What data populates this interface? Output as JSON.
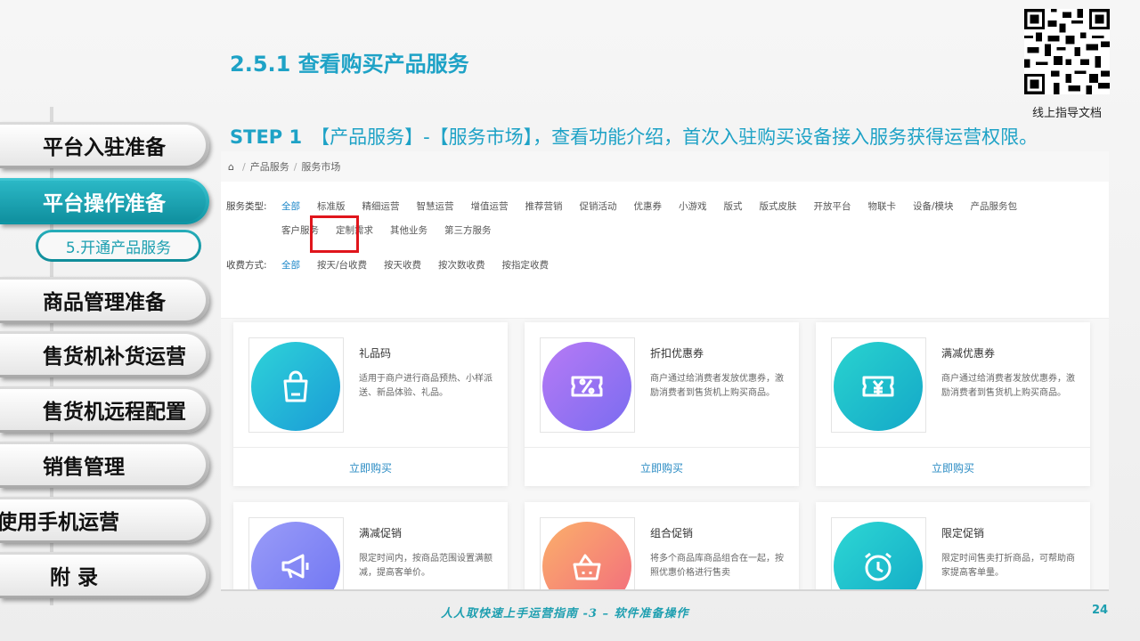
{
  "slide": {
    "title": "2.5.1 查看购买产品服务",
    "qr_label": "线上指导文档",
    "step_label": "STEP 1",
    "step_text": "【产品服务】-【服务市场】，查看功能介绍，首次入驻购买设备接入服务获得运营权限。",
    "footer": "人人取快速上手运营指南 -3 – 软件准备操作",
    "page_number": "24"
  },
  "sidebar": {
    "items": [
      {
        "label": "平台入驻准备"
      },
      {
        "label": "平台操作准备"
      },
      {
        "label": "商品管理准备"
      },
      {
        "label": "售货机补货运营"
      },
      {
        "label": "售货机远程配置"
      },
      {
        "label": "销售管理"
      },
      {
        "label": "使用手机运营"
      },
      {
        "label": "附 录"
      }
    ],
    "sub_item": "5.开通产品服务",
    "active_index": 1
  },
  "screenshot": {
    "breadcrumb": [
      "产品服务",
      "服务市场"
    ],
    "service_type_label": "服务类型:",
    "service_types": [
      "全部",
      "标准版",
      "精细运营",
      "智慧运营",
      "增值运营",
      "推荐营销",
      "促销活动",
      "优惠券",
      "小游戏",
      "版式",
      "版式皮肤",
      "开放平台",
      "物联卡",
      "设备/模块",
      "产品服务包",
      "客户服务",
      "定制需求",
      "其他业务",
      "第三方服务"
    ],
    "charge_label": "收费方式:",
    "charge_types": [
      "全部",
      "按天/台收费",
      "按天收费",
      "按次数收费",
      "按指定收费"
    ],
    "buy_label": "立即购买",
    "cards": [
      {
        "name": "礼品码",
        "desc": "适用于商户进行商品预热、小样派送、新品体验、礼品。",
        "icon": "shopping-bag-icon",
        "color_a": "#2ed3d9",
        "color_b": "#1a9bd6"
      },
      {
        "name": "折扣优惠券",
        "desc": "商户通过给消费者发放优惠券，激励消费者到售货机上购买商品。",
        "icon": "percent-coupon-icon",
        "color_a": "#b77af5",
        "color_b": "#7a6cf0"
      },
      {
        "name": "满减优惠券",
        "desc": "商户通过给消费者发放优惠券，激励消费者到售货机上购买商品。",
        "icon": "yen-coupon-icon",
        "color_a": "#29d3cf",
        "color_b": "#14a8c8"
      },
      {
        "name": "满减促销",
        "desc": "限定时间内，按商品范围设置满额减，提高客单价。",
        "icon": "megaphone-icon",
        "color_a": "#9a9cf8",
        "color_b": "#6e74f2"
      },
      {
        "name": "组合促销",
        "desc": "将多个商品库商品组合在一起，按照优惠价格进行售卖",
        "icon": "combo-basket-icon",
        "color_a": "#fbb06a",
        "color_b": "#f26a7e"
      },
      {
        "name": "限定促销",
        "desc": "限定时间售卖打折商品，可帮助商家提高客单量。",
        "icon": "alarm-clock-icon",
        "color_a": "#2dd7d4",
        "color_b": "#12a9c6"
      }
    ]
  }
}
